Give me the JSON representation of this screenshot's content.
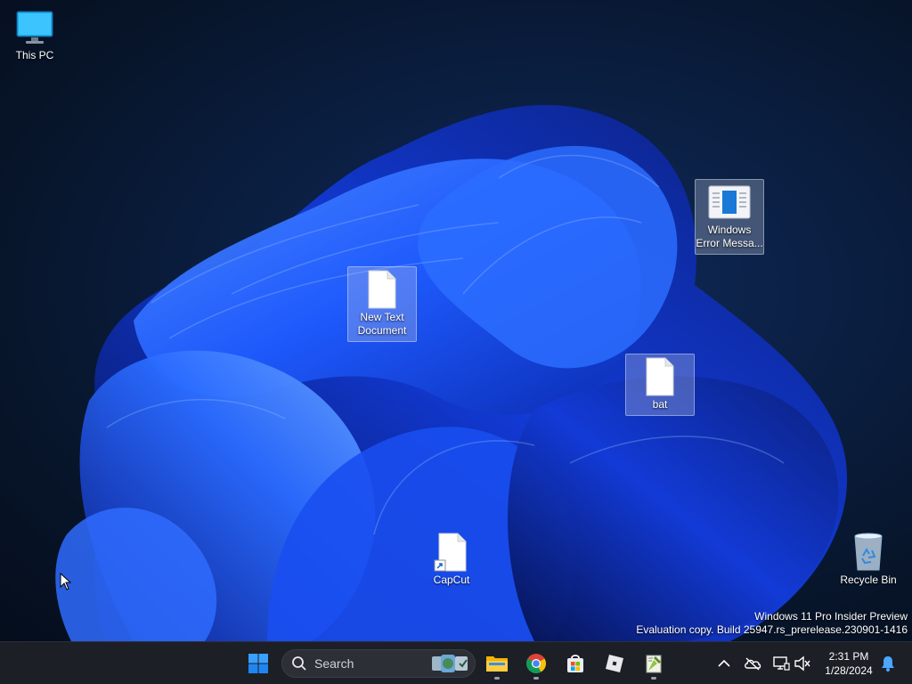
{
  "desktop": {
    "icons": {
      "this_pc": "This PC",
      "new_text_document": "New Text Document",
      "windows_error_message": "Windows Error Messa...",
      "bat": "bat",
      "capcut": "CapCut",
      "recycle_bin": "Recycle Bin"
    },
    "watermark": {
      "line1": "Windows 11 Pro Insider Preview",
      "line2": "Evaluation copy. Build 25947.rs_prerelease.230901-1416"
    }
  },
  "taskbar": {
    "search_placeholder": "Search",
    "pinned": [
      "start-icon",
      "file-explorer-icon",
      "chrome-icon",
      "microsoft-store-icon",
      "roblox-icon",
      "notepad-plus-icon"
    ],
    "tray": {
      "time": "2:31 PM",
      "date": "1/28/2024"
    }
  },
  "colors": {
    "accent": "#1e6fff",
    "taskbar_bg": "#1c1f26",
    "desktop_bg": "#0a1d3e"
  }
}
